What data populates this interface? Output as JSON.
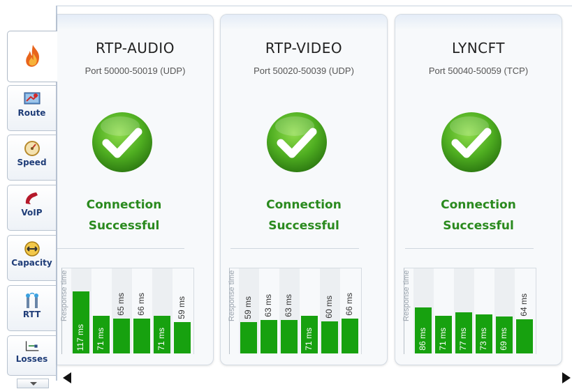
{
  "sidebar": {
    "tabs": [
      {
        "id": "home",
        "label": "",
        "icon": "flame-icon",
        "active": true
      },
      {
        "id": "route",
        "label": "Route",
        "icon": "route-map-icon"
      },
      {
        "id": "speed",
        "label": "Speed",
        "icon": "speedometer-icon"
      },
      {
        "id": "voip",
        "label": "VoIP",
        "icon": "phone-handset-icon"
      },
      {
        "id": "capacity",
        "label": "Capacity",
        "icon": "double-arrow-icon"
      },
      {
        "id": "rtt",
        "label": "RTT",
        "icon": "antennas-icon"
      },
      {
        "id": "losses",
        "label": "Losses",
        "icon": "loss-graph-icon"
      }
    ]
  },
  "cards": [
    {
      "title": "RTP-AUDIO",
      "port": "Port 50000-50019 (UDP)",
      "status_line1": "Connection",
      "status_line2": "Successful",
      "chart_ylabel": "Response time",
      "values_ms": [
        117,
        71,
        65,
        66,
        71,
        59
      ],
      "labels": [
        "117 ms",
        "71 ms",
        "65 ms",
        "66 ms",
        "71 ms",
        "59 ms"
      ]
    },
    {
      "title": "RTP-VIDEO",
      "port": "Port 50020-50039 (UDP)",
      "status_line1": "Connection",
      "status_line2": "Successful",
      "chart_ylabel": "Response time",
      "values_ms": [
        59,
        63,
        63,
        71,
        60,
        66
      ],
      "labels": [
        "59 ms",
        "63 ms",
        "63 ms",
        "71 ms",
        "60 ms",
        "66 ms"
      ]
    },
    {
      "title": "LYNCFT",
      "port": "Port 50040-50059 (TCP)",
      "status_line1": "Connection",
      "status_line2": "Successful",
      "chart_ylabel": "Response time",
      "values_ms": [
        86,
        71,
        77,
        73,
        69,
        64
      ],
      "labels": [
        "86 ms",
        "71 ms",
        "77 ms",
        "73 ms",
        "69 ms",
        "64 ms"
      ]
    }
  ],
  "colors": {
    "success_green": "#2a8a1e",
    "bar_green": "#17a10f",
    "tab_text": "#1f3d78"
  }
}
